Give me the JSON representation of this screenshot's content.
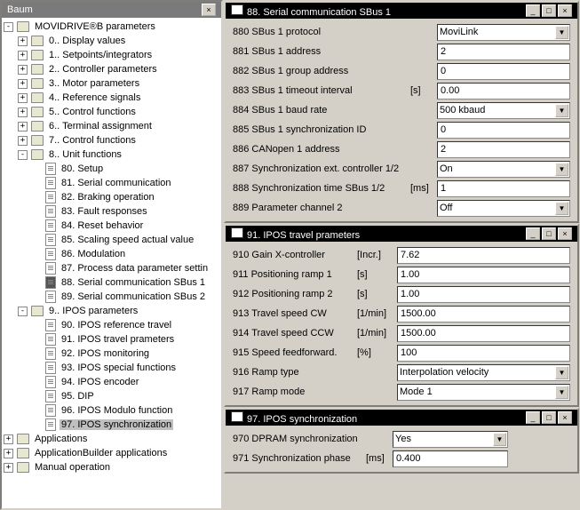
{
  "tree_panel": {
    "title": "Baum"
  },
  "tree": {
    "root": "MOVIDRIVE®B parameters",
    "items": [
      "0.. Display values",
      "1.. Setpoints/integrators",
      "2.. Controller parameters",
      "3.. Motor parameters",
      "4.. Reference signals",
      "5.. Control functions",
      "6.. Terminal assignment",
      "7.. Control functions"
    ],
    "unit_functions": "8.. Unit functions",
    "unit_items": [
      "80. Setup",
      "81. Serial communication",
      "82. Braking operation",
      "83. Fault responses",
      "84. Reset behavior",
      "85. Scaling speed actual value",
      "86. Modulation",
      "87. Process data parameter settin",
      "88. Serial communication SBus 1",
      "89. Serial communication SBus 2"
    ],
    "ipos_params": "9.. IPOS parameters",
    "ipos_items": [
      "90. IPOS reference travel",
      "91. IPOS travel prameters",
      "92. IPOS monitoring",
      "93. IPOS special functions",
      "94. IPOS encoder",
      "95. DIP",
      "96. IPOS Modulo function",
      "97. IPOS synchronization"
    ],
    "bottom": [
      "Applications",
      "ApplicationBuilder applications",
      "Manual operation"
    ]
  },
  "win88": {
    "title": "88. Serial communication SBus 1",
    "rows": [
      {
        "label": "880 SBus 1 protocol",
        "value": "MoviLink",
        "type": "select"
      },
      {
        "label": "881 SBus 1 address",
        "value": "2",
        "type": "input"
      },
      {
        "label": "882 SBus 1 group address",
        "value": "0",
        "type": "input"
      },
      {
        "label": "883 SBus 1 timeout interval",
        "unit": "[s]",
        "value": "0.00",
        "type": "input"
      },
      {
        "label": "884 SBus 1 baud rate",
        "value": "500 kbaud",
        "type": "select"
      },
      {
        "label": "885 SBus 1 synchronization ID",
        "value": "0",
        "type": "input"
      },
      {
        "label": "886 CANopen 1 address",
        "value": "2",
        "type": "input"
      },
      {
        "label": "887 Synchronization ext. controller 1/2",
        "value": "On",
        "type": "select"
      },
      {
        "label": "888 Synchronization time SBus 1/2",
        "unit": "[ms]",
        "value": "1",
        "type": "input"
      },
      {
        "label": "889 Parameter channel 2",
        "value": "Off",
        "type": "select"
      }
    ]
  },
  "win91": {
    "title": "91. IPOS travel prameters",
    "rows": [
      {
        "label": "910 Gain X-controller",
        "unit": "[Incr.]",
        "value": "7.62",
        "type": "input"
      },
      {
        "label": "911 Positioning ramp 1",
        "unit": "[s]",
        "value": "1.00",
        "type": "input"
      },
      {
        "label": "912 Positioning ramp 2",
        "unit": "[s]",
        "value": "1.00",
        "type": "input"
      },
      {
        "label": "913 Travel speed CW",
        "unit": "[1/min]",
        "value": "1500.00",
        "type": "input"
      },
      {
        "label": "914 Travel speed CCW",
        "unit": "[1/min]",
        "value": "1500.00",
        "type": "input"
      },
      {
        "label": "915 Speed feedforward.",
        "unit": "[%]",
        "value": "100",
        "type": "input"
      },
      {
        "label": "916 Ramp type",
        "value": "Interpolation velocity",
        "type": "select"
      },
      {
        "label": "917 Ramp mode",
        "value": "Mode 1",
        "type": "select"
      }
    ]
  },
  "win97": {
    "title": "97. IPOS synchronization",
    "rows": [
      {
        "label": "970 DPRAM synchronization",
        "value": "Yes",
        "type": "select",
        "narrow": true
      },
      {
        "label": "971 Synchronization phase",
        "unit": "[ms]",
        "value": "0.400",
        "type": "input",
        "narrow": true
      }
    ]
  }
}
